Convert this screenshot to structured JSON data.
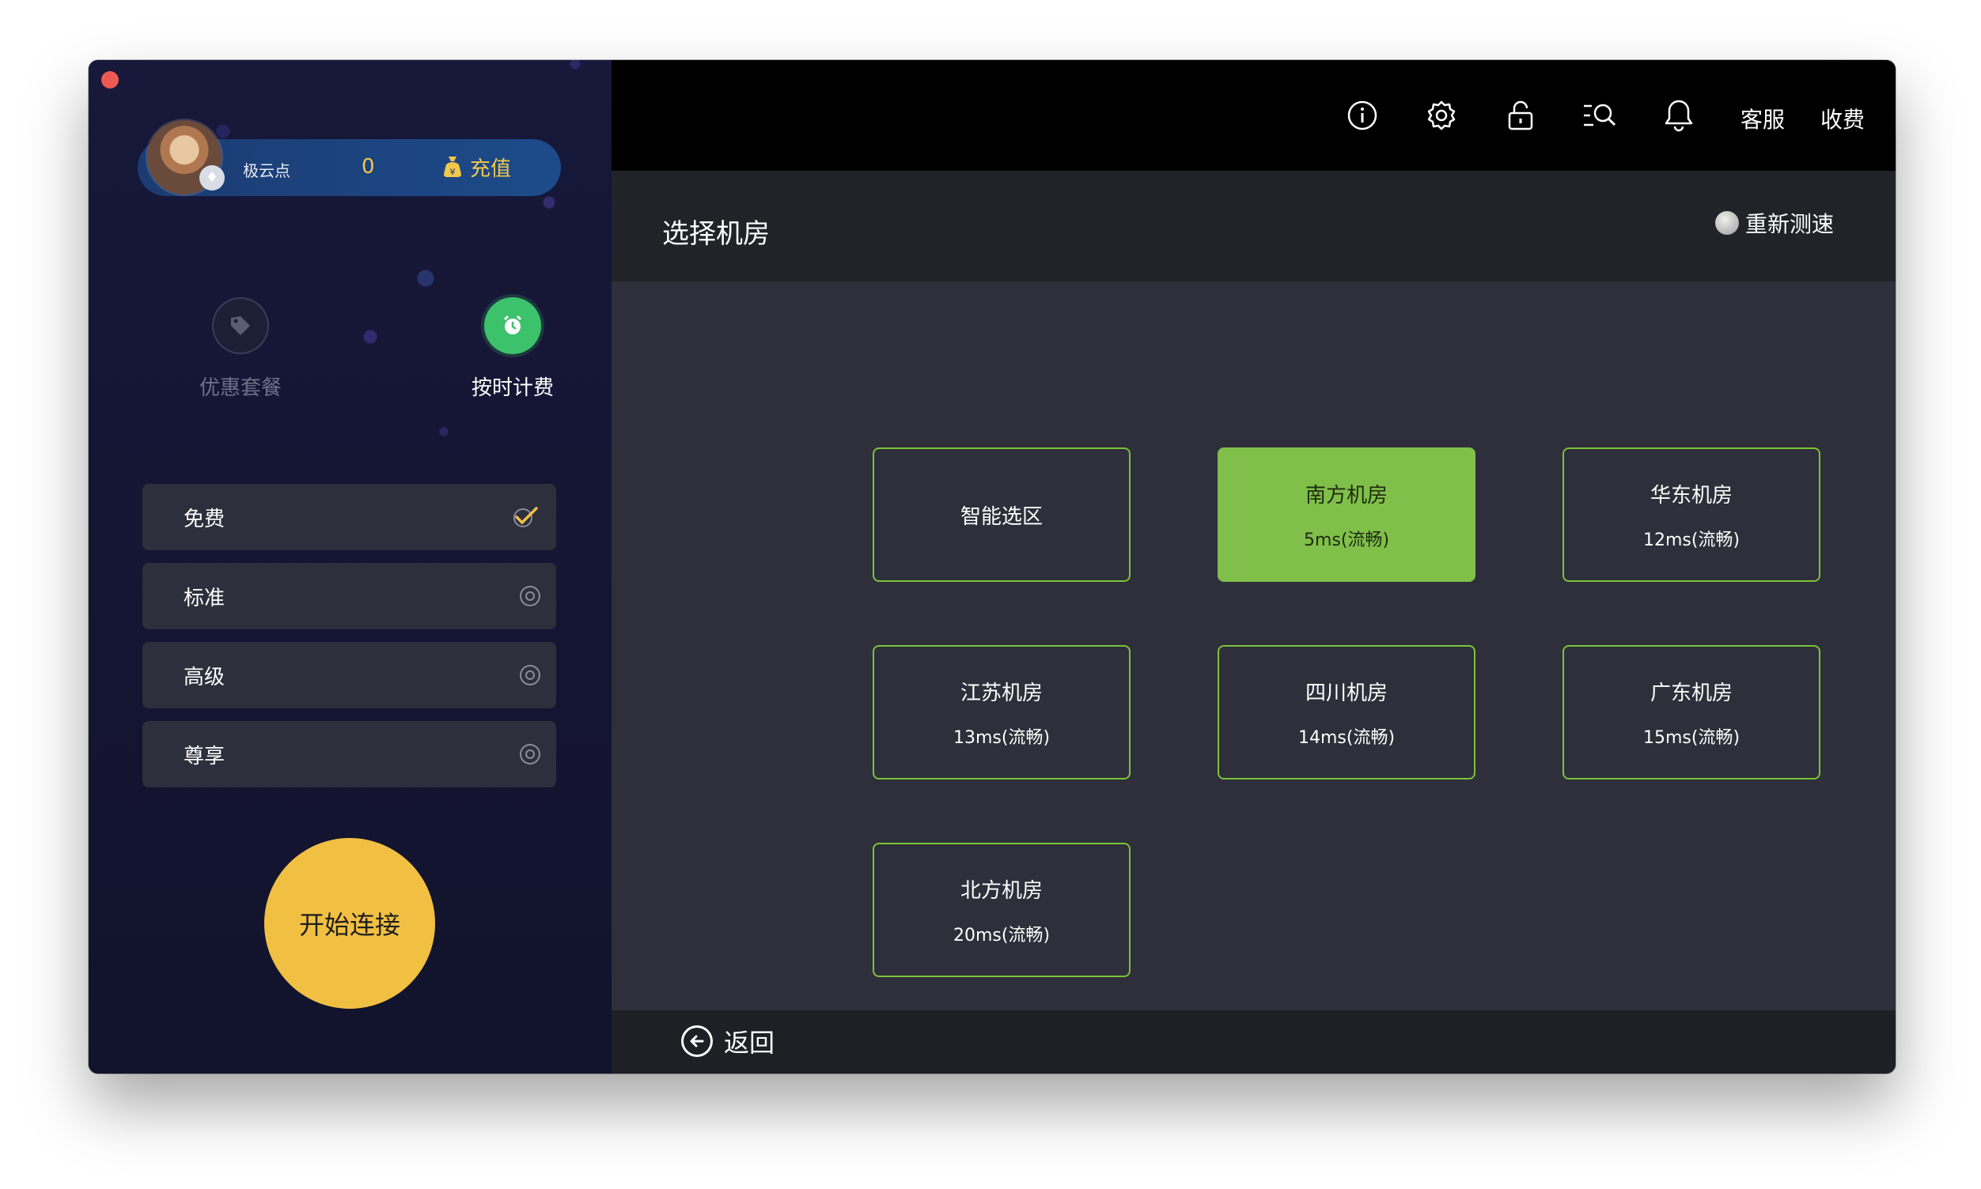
{
  "sidebar": {
    "user": {
      "name": "极云点",
      "points": "0",
      "recharge_label": "充值"
    },
    "plan_tabs": [
      {
        "label": "优惠套餐",
        "icon": "tag-icon",
        "active": false
      },
      {
        "label": "按时计费",
        "icon": "alarm-clock-icon",
        "active": true
      }
    ],
    "tiers": [
      {
        "label": "免费",
        "selected": true
      },
      {
        "label": "标准",
        "selected": false
      },
      {
        "label": "高级",
        "selected": false
      },
      {
        "label": "尊享",
        "selected": false
      }
    ],
    "connect_label": "开始连接"
  },
  "topbar": {
    "icons": [
      "info-icon",
      "gear-icon",
      "unlock-icon",
      "search-list-icon",
      "bell-icon",
      "refresh-icon"
    ],
    "customer_service": "客服",
    "billing": "收费"
  },
  "main": {
    "title": "选择机房",
    "retest_label": "重新测速",
    "rooms": [
      {
        "name": "智能选区",
        "ping": ""
      },
      {
        "name": "南方机房",
        "ping": "5ms(流畅)",
        "selected": true
      },
      {
        "name": "华东机房",
        "ping": "12ms(流畅)"
      },
      {
        "name": "江苏机房",
        "ping": "13ms(流畅)"
      },
      {
        "name": "四川机房",
        "ping": "14ms(流畅)"
      },
      {
        "name": "广东机房",
        "ping": "15ms(流畅)"
      },
      {
        "name": "北方机房",
        "ping": "20ms(流畅)"
      }
    ],
    "back_label": "返回"
  },
  "colors": {
    "accent_green": "#7fbf4a",
    "connect_yellow": "#f1c043",
    "sidebar_bg": "#141630"
  }
}
